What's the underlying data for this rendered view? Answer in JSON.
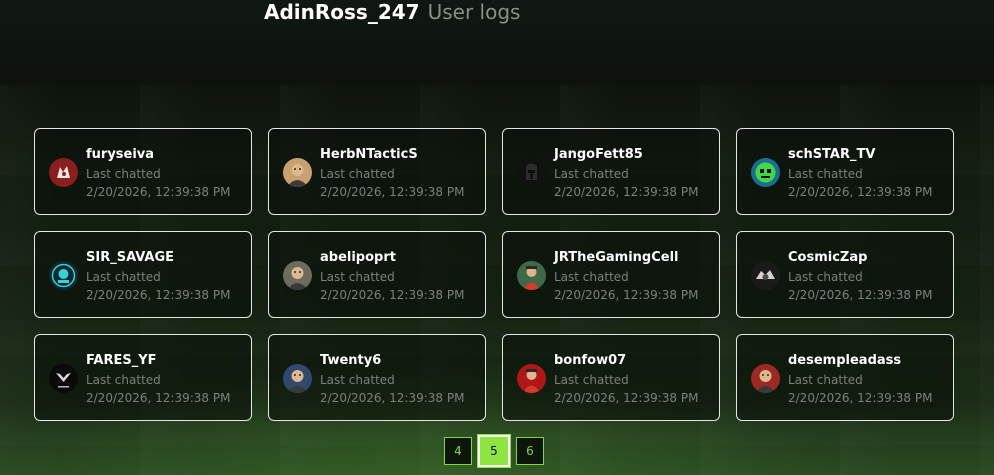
{
  "header": {
    "channel": "AdinRoss_247",
    "subtitle": "User logs"
  },
  "users": [
    {
      "name": "furyseiva",
      "label": "Last chatted",
      "time": "2/20/2026, 12:39:38 PM",
      "avatar": "wolf-icon",
      "color": "#8b1e1e"
    },
    {
      "name": "HerbNTacticS",
      "label": "Last chatted",
      "time": "2/20/2026, 12:39:38 PM",
      "avatar": "face-icon",
      "color": "#c9a070"
    },
    {
      "name": "JangoFett85",
      "label": "Last chatted",
      "time": "2/20/2026, 12:39:38 PM",
      "avatar": "helmet-icon",
      "color": "#2a2e2a"
    },
    {
      "name": "schSTAR_TV",
      "label": "Last chatted",
      "time": "2/20/2026, 12:39:38 PM",
      "avatar": "robot-icon",
      "color": "#3fd84a"
    },
    {
      "name": "SIR_SAVAGE",
      "label": "Last chatted",
      "time": "2/20/2026, 12:39:38 PM",
      "avatar": "skull-logo-icon",
      "color": "#0d2a30"
    },
    {
      "name": "abelipoprt",
      "label": "Last chatted",
      "time": "2/20/2026, 12:39:38 PM",
      "avatar": "face-icon",
      "color": "#6d6a5e"
    },
    {
      "name": "JRTheGamingCell",
      "label": "Last chatted",
      "time": "2/20/2026, 12:39:38 PM",
      "avatar": "character-icon",
      "color": "#3e6a4a"
    },
    {
      "name": "CosmicZap",
      "label": "Last chatted",
      "time": "2/20/2026, 12:39:38 PM",
      "avatar": "emblem-icon",
      "color": "#d8d2c6"
    },
    {
      "name": "FARES_YF",
      "label": "Last chatted",
      "time": "2/20/2026, 12:39:38 PM",
      "avatar": "eagle-logo-icon",
      "color": "#0a0a0a"
    },
    {
      "name": "Twenty6",
      "label": "Last chatted",
      "time": "2/20/2026, 12:39:38 PM",
      "avatar": "face-icon",
      "color": "#2f4a6e"
    },
    {
      "name": "bonfow07",
      "label": "Last chatted",
      "time": "2/20/2026, 12:39:38 PM",
      "avatar": "character-icon",
      "color": "#b01818"
    },
    {
      "name": "desempleadass",
      "label": "Last chatted",
      "time": "2/20/2026, 12:39:38 PM",
      "avatar": "face-icon",
      "color": "#9a2a22"
    }
  ],
  "pagination": {
    "pages": [
      "4",
      "5",
      "6"
    ],
    "current": "5"
  }
}
